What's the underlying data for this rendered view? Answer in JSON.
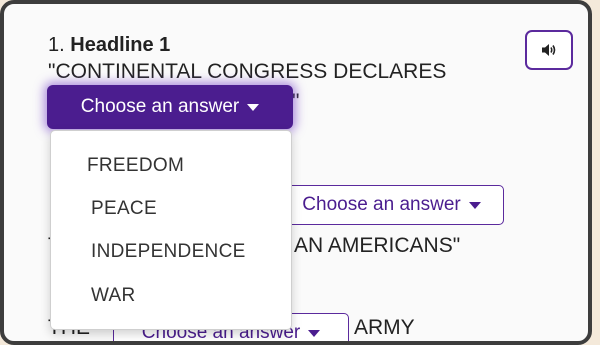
{
  "question": {
    "number": "1.",
    "title": "Headline 1",
    "line1": "\"CONTINENTAL CONGRESS DECLARES",
    "quote_fragment": "\"",
    "line3_left": "T",
    "line3_right": "AN AMERICANS\"",
    "line4_left": "THE",
    "line4_right": "ARMY"
  },
  "icons": {
    "audio": "speaker-volume-icon",
    "caret": "caret-down-icon"
  },
  "selects": {
    "open_label": "Choose an answer",
    "second_label": "Choose an answer",
    "third_label": "Choose an answer"
  },
  "dropdown": {
    "options": [
      "FREEDOM",
      "PEACE",
      "INDEPENDENCE",
      "WAR"
    ]
  },
  "colors": {
    "accent": "#4b1d8f",
    "background": "#f4e9da"
  }
}
